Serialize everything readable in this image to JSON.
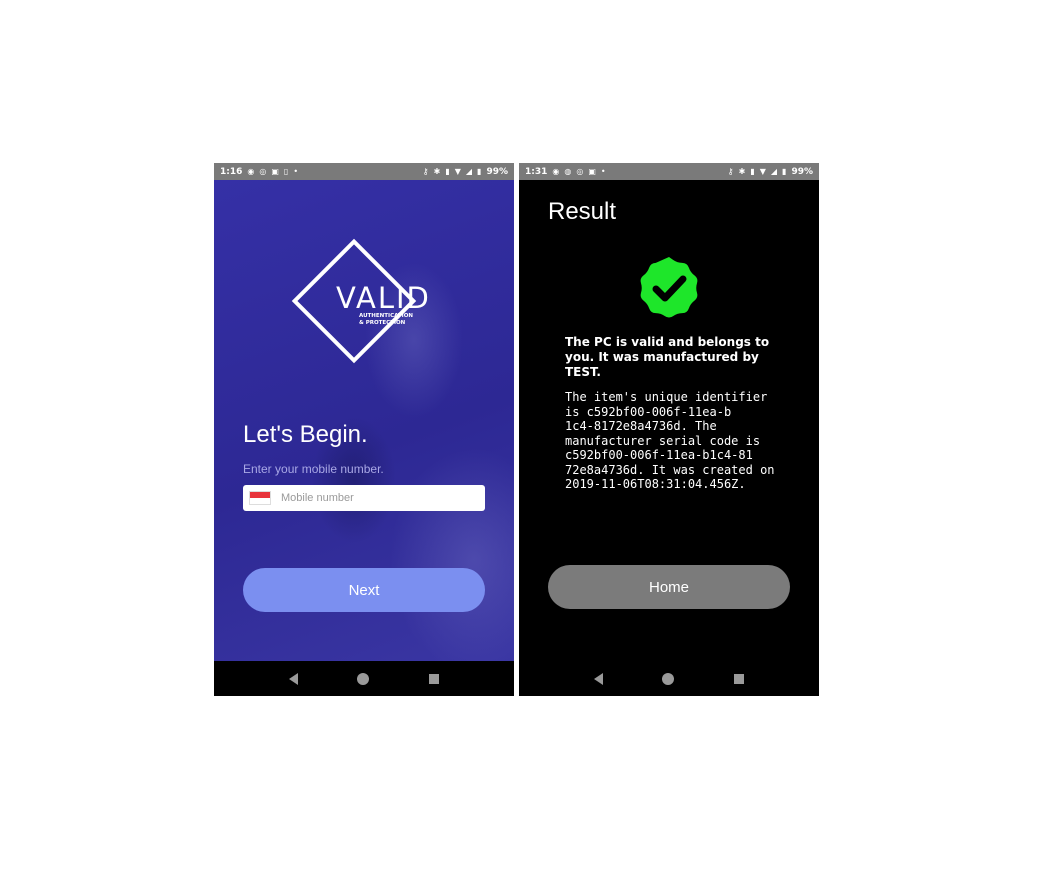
{
  "left_screen": {
    "status": {
      "time": "1:16",
      "battery": "99%",
      "left_icons": [
        "spotify-icon",
        "messenger-icon",
        "instagram-icon",
        "sim-icon",
        "dot-icon"
      ],
      "right_icons": [
        "key-icon",
        "bluetooth-icon",
        "vibrate-icon",
        "wifi-icon",
        "signal-icon",
        "battery-icon"
      ]
    },
    "logo": {
      "name": "VALID",
      "tagline_line1": "AUTHENTICATION",
      "tagline_line2": "& PROTECTION"
    },
    "heading": "Let's Begin.",
    "hint": "Enter your mobile number.",
    "phone_input": {
      "placeholder": "Mobile number",
      "value": "",
      "flag": "singapore-flag-icon"
    },
    "next_button": "Next",
    "accent_color": "#2f2a9a",
    "button_color": "#7b8ff0"
  },
  "right_screen": {
    "status": {
      "time": "1:31",
      "battery": "99%",
      "left_icons": [
        "spotify-icon",
        "maps-icon",
        "messenger-icon",
        "instagram-icon",
        "dot-icon"
      ],
      "right_icons": [
        "key-icon",
        "bluetooth-icon",
        "vibrate-icon",
        "wifi-icon",
        "signal-icon",
        "battery-icon"
      ]
    },
    "title": "Result",
    "badge_icon": "verified-check-icon",
    "badge_color": "#1ee62a",
    "main_message": "The PC is valid and belongs to you. It was manufactured by TEST.",
    "detail_lines": [
      "The item's unique identifier",
      "is c592bf00-006f-11ea-b",
      "1c4-8172e8a4736d. The",
      "manufacturer serial code is",
      "c592bf00-006f-11ea-b1c4-81",
      "72e8a4736d. It was created on",
      "2019-11-06T08:31:04.456Z."
    ],
    "home_button": "Home"
  }
}
